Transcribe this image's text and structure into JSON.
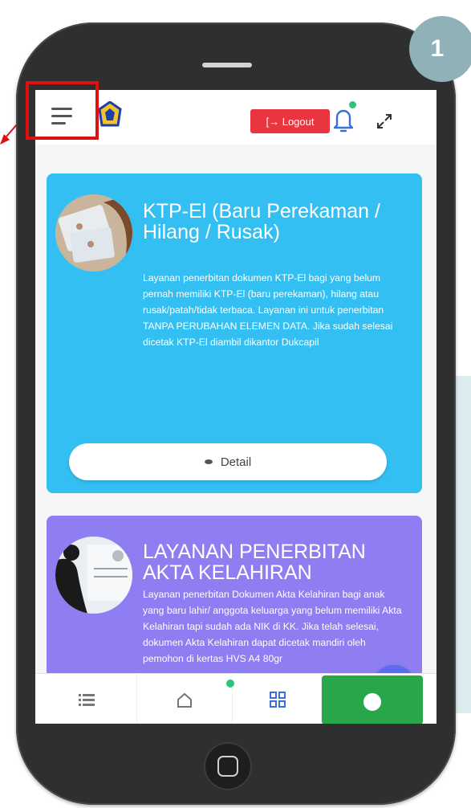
{
  "step_badge": "1",
  "topbar": {
    "menu_icon": "hamburger-menu-icon",
    "logo_icon": "dukcapil-logo-icon",
    "logout_label": "[→ Logout",
    "notification_icon": "bell-icon",
    "expand_icon": "fullscreen-icon"
  },
  "cards": [
    {
      "title": "KTP-El (Baru Perekaman / Hilang / Rusak)",
      "description": "Layanan penerbitan dokumen KTP-El bagi yang belum pernah memiliki KTP-El (baru perekaman), hilang atau rusak/patah/tidak terbaca. Layanan ini untuk penerbitan TANPA PERUBAHAN ELEMEN DATA. Jika sudah selesai dicetak KTP-El diambil dikantor Dukcapil",
      "button_label": "Detail",
      "color": "#34bff2"
    },
    {
      "title": "LAYANAN PENERBITAN AKTA KELAHIRAN",
      "description": "Layanan penerbitan Dokumen Akta Kelahiran bagi anak yang baru lahir/ anggota keluarga yang belum memiliki Akta Kelahiran tapi sudah ada NIK di KK. Jika telah selesai, dokumen Akta Kelahiran dapat dicetak mandiri oleh pemohon di kertas HVS A4 80gr",
      "color": "#8e7ef2"
    }
  ],
  "scroll_top_label": "˄",
  "bottom_nav": {
    "items": [
      "list-icon",
      "home-icon",
      "grid-icon",
      "chat-icon"
    ],
    "accent": "#27a74a"
  },
  "colors": {
    "annotation": "#e01010",
    "logout": "#e8353f"
  }
}
